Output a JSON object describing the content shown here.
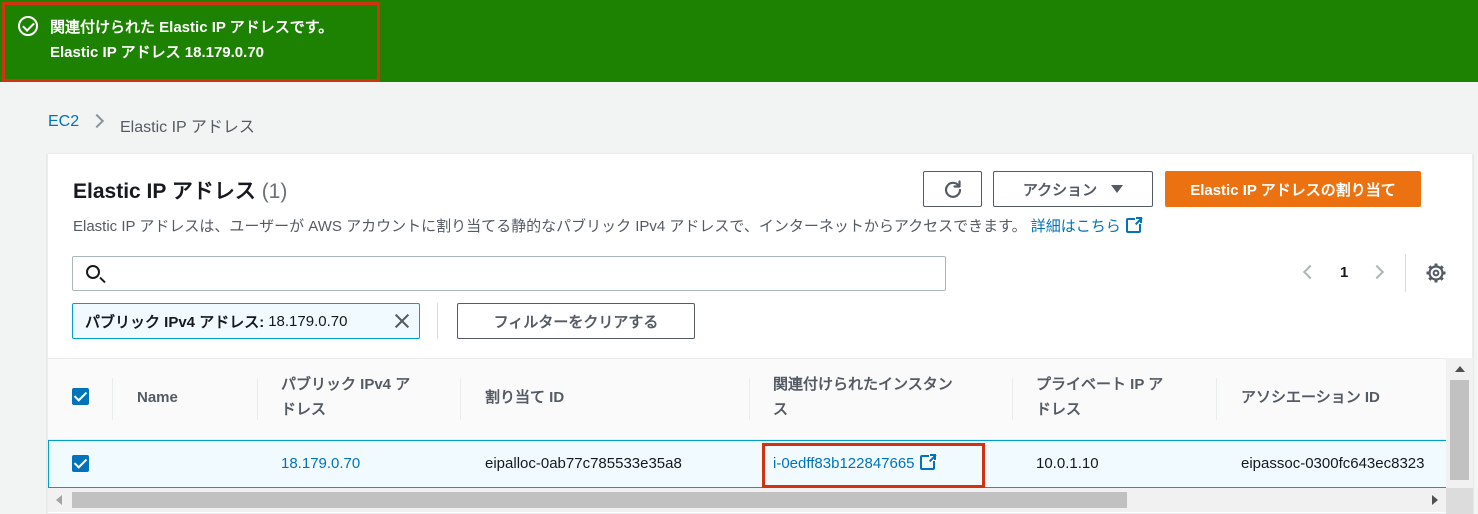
{
  "flash": {
    "title": "関連付けられた Elastic IP アドレスです。",
    "message": "Elastic IP アドレス 18.179.0.70"
  },
  "breadcrumb": {
    "root": "EC2",
    "current": "Elastic IP アドレス"
  },
  "panel": {
    "title": "Elastic IP アドレス",
    "count": "(1)",
    "description": "Elastic IP アドレスは、ユーザーが AWS アカウントに割り当てる静的なパブリック IPv4 アドレスで、インターネットからアクセスできます。",
    "learn_more": "詳細はこちら"
  },
  "toolbar": {
    "actions_label": "アクション",
    "allocate_label": "Elastic IP アドレスの割り当て"
  },
  "search": {
    "placeholder": "",
    "value": ""
  },
  "pagination": {
    "current_page": "1"
  },
  "filter": {
    "token_key": "パブリック IPv4 アドレス:",
    "token_value": "18.179.0.70",
    "clear_label": "フィルターをクリアする"
  },
  "table": {
    "columns": {
      "name": "Name",
      "public_ip_l1": "パブリック IPv4 ア",
      "public_ip_l2": "ドレス",
      "allocation_id": "割り当て ID",
      "instance_l1": "関連付けられたインスタン",
      "instance_l2": "ス",
      "private_ip_l1": "プライベート IP ア",
      "private_ip_l2": "ドレス",
      "association_id": "アソシエーション ID"
    },
    "rows": [
      {
        "name": "",
        "public_ip": "18.179.0.70",
        "allocation_id": "eipalloc-0ab77c785533e35a8",
        "instance": "i-0edff83b122847665",
        "private_ip": "10.0.1.10",
        "association_id": "eipassoc-0300fc643ec8323"
      }
    ]
  },
  "colors": {
    "success": "#1d8102",
    "primary": "#ec7211",
    "link": "#0073bb",
    "highlight": "#d13212"
  }
}
